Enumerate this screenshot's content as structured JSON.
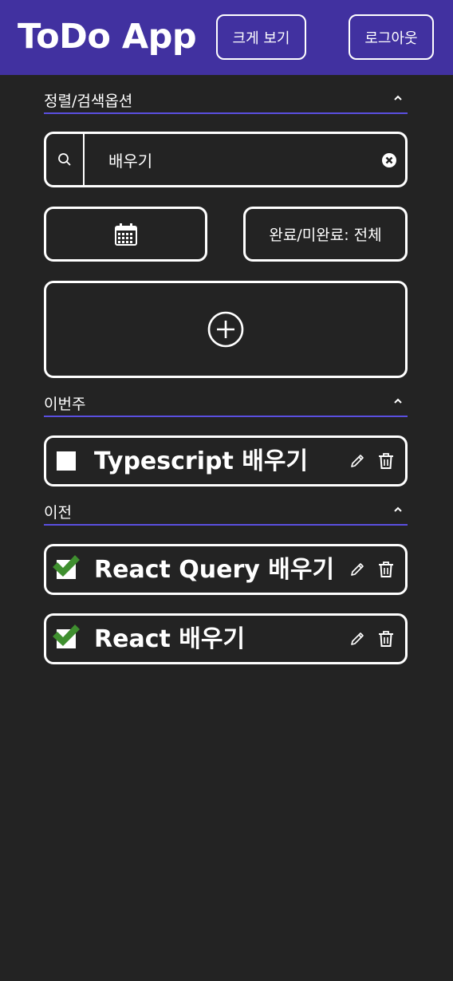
{
  "header": {
    "title": "ToDo App",
    "zoom_button": "크게 보기",
    "logout_button": "로그아웃"
  },
  "options": {
    "title": "정렬/검색옵션",
    "search": {
      "value": "배우기",
      "icon": "search-icon",
      "clear_icon": "clear-icon"
    },
    "date_button_icon": "calendar-icon",
    "filter_button": "완료/미완료: 전체",
    "add_button_icon": "plus-circle-icon"
  },
  "sections": [
    {
      "title": "이번주",
      "todos": [
        {
          "text": "Typescript 배우기",
          "completed": false
        }
      ]
    },
    {
      "title": "이전",
      "todos": [
        {
          "text": "React Query 배우기",
          "completed": true
        },
        {
          "text": "React 배우기",
          "completed": true
        }
      ]
    }
  ],
  "colors": {
    "header_bg": "#4131a0",
    "page_bg": "#232323",
    "section_underline": "#5a4fe0",
    "check_green": "#3f8f2f"
  }
}
